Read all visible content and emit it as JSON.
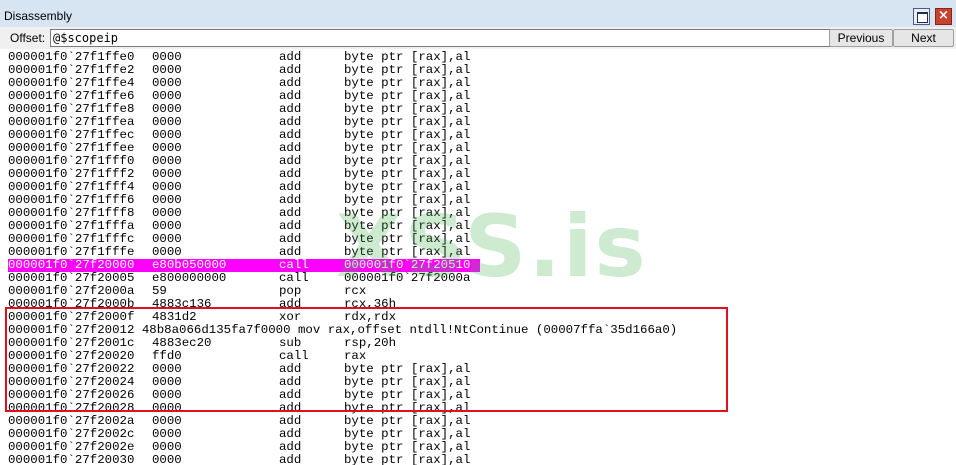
{
  "window": {
    "title": "Disassembly",
    "restore_icon": "restore-window-icon",
    "close_icon": "close-icon",
    "close_glyph": "×"
  },
  "toolbar": {
    "offset_label": "Offset:",
    "offset_value": "@$scopeip",
    "previous_label": "Previous",
    "next_label": "Next"
  },
  "watermark": "XSS.is",
  "colors": {
    "highlight_bg": "#ff00ff",
    "highlight_fg": "#ffffff",
    "annotation_box": "#e0101e",
    "watermark": "#3fae4a"
  },
  "rows": [
    {
      "addr": "000001f0`27f1ffe0",
      "bytes": "0000",
      "mnemonic": "add",
      "operands": "byte ptr [rax],al"
    },
    {
      "addr": "000001f0`27f1ffe2",
      "bytes": "0000",
      "mnemonic": "add",
      "operands": "byte ptr [rax],al"
    },
    {
      "addr": "000001f0`27f1ffe4",
      "bytes": "0000",
      "mnemonic": "add",
      "operands": "byte ptr [rax],al"
    },
    {
      "addr": "000001f0`27f1ffe6",
      "bytes": "0000",
      "mnemonic": "add",
      "operands": "byte ptr [rax],al"
    },
    {
      "addr": "000001f0`27f1ffe8",
      "bytes": "0000",
      "mnemonic": "add",
      "operands": "byte ptr [rax],al"
    },
    {
      "addr": "000001f0`27f1ffea",
      "bytes": "0000",
      "mnemonic": "add",
      "operands": "byte ptr [rax],al"
    },
    {
      "addr": "000001f0`27f1ffec",
      "bytes": "0000",
      "mnemonic": "add",
      "operands": "byte ptr [rax],al"
    },
    {
      "addr": "000001f0`27f1ffee",
      "bytes": "0000",
      "mnemonic": "add",
      "operands": "byte ptr [rax],al"
    },
    {
      "addr": "000001f0`27f1fff0",
      "bytes": "0000",
      "mnemonic": "add",
      "operands": "byte ptr [rax],al"
    },
    {
      "addr": "000001f0`27f1fff2",
      "bytes": "0000",
      "mnemonic": "add",
      "operands": "byte ptr [rax],al"
    },
    {
      "addr": "000001f0`27f1fff4",
      "bytes": "0000",
      "mnemonic": "add",
      "operands": "byte ptr [rax],al"
    },
    {
      "addr": "000001f0`27f1fff6",
      "bytes": "0000",
      "mnemonic": "add",
      "operands": "byte ptr [rax],al"
    },
    {
      "addr": "000001f0`27f1fff8",
      "bytes": "0000",
      "mnemonic": "add",
      "operands": "byte ptr [rax],al"
    },
    {
      "addr": "000001f0`27f1fffa",
      "bytes": "0000",
      "mnemonic": "add",
      "operands": "byte ptr [rax],al"
    },
    {
      "addr": "000001f0`27f1fffc",
      "bytes": "0000",
      "mnemonic": "add",
      "operands": "byte ptr [rax],al"
    },
    {
      "addr": "000001f0`27f1fffe",
      "bytes": "0000",
      "mnemonic": "add",
      "operands": "byte ptr [rax],al"
    },
    {
      "addr": "000001f0`27f20000",
      "bytes": "e80b050000",
      "mnemonic": "call",
      "operands": "000001f0`27f20510",
      "highlight": true
    },
    {
      "addr": "000001f0`27f20005",
      "bytes": "e800000000",
      "mnemonic": "call",
      "operands": "000001f0`27f2000a"
    },
    {
      "addr": "000001f0`27f2000a",
      "bytes": "59",
      "mnemonic": "pop",
      "operands": "rcx"
    },
    {
      "addr": "000001f0`27f2000b",
      "bytes": "4883c136",
      "mnemonic": "add",
      "operands": "rcx,36h"
    },
    {
      "addr": "000001f0`27f2000f",
      "bytes": "4831d2",
      "mnemonic": "xor",
      "operands": "rdx,rdx"
    },
    {
      "full": "000001f0`27f20012 48b8a066d135fa7f0000 mov rax,offset ntdll!NtContinue (00007ffa`35d166a0)"
    },
    {
      "addr": "000001f0`27f2001c",
      "bytes": "4883ec20",
      "mnemonic": "sub",
      "operands": "rsp,20h"
    },
    {
      "addr": "000001f0`27f20020",
      "bytes": "ffd0",
      "mnemonic": "call",
      "operands": "rax"
    },
    {
      "addr": "000001f0`27f20022",
      "bytes": "0000",
      "mnemonic": "add",
      "operands": "byte ptr [rax],al"
    },
    {
      "addr": "000001f0`27f20024",
      "bytes": "0000",
      "mnemonic": "add",
      "operands": "byte ptr [rax],al"
    },
    {
      "addr": "000001f0`27f20026",
      "bytes": "0000",
      "mnemonic": "add",
      "operands": "byte ptr [rax],al"
    },
    {
      "addr": "000001f0`27f20028",
      "bytes": "0000",
      "mnemonic": "add",
      "operands": "byte ptr [rax],al"
    },
    {
      "addr": "000001f0`27f2002a",
      "bytes": "0000",
      "mnemonic": "add",
      "operands": "byte ptr [rax],al"
    },
    {
      "addr": "000001f0`27f2002c",
      "bytes": "0000",
      "mnemonic": "add",
      "operands": "byte ptr [rax],al"
    },
    {
      "addr": "000001f0`27f2002e",
      "bytes": "0000",
      "mnemonic": "add",
      "operands": "byte ptr [rax],al"
    },
    {
      "addr": "000001f0`27f20030",
      "bytes": "0000",
      "mnemonic": "add",
      "operands": "byte ptr [rax],al"
    }
  ]
}
